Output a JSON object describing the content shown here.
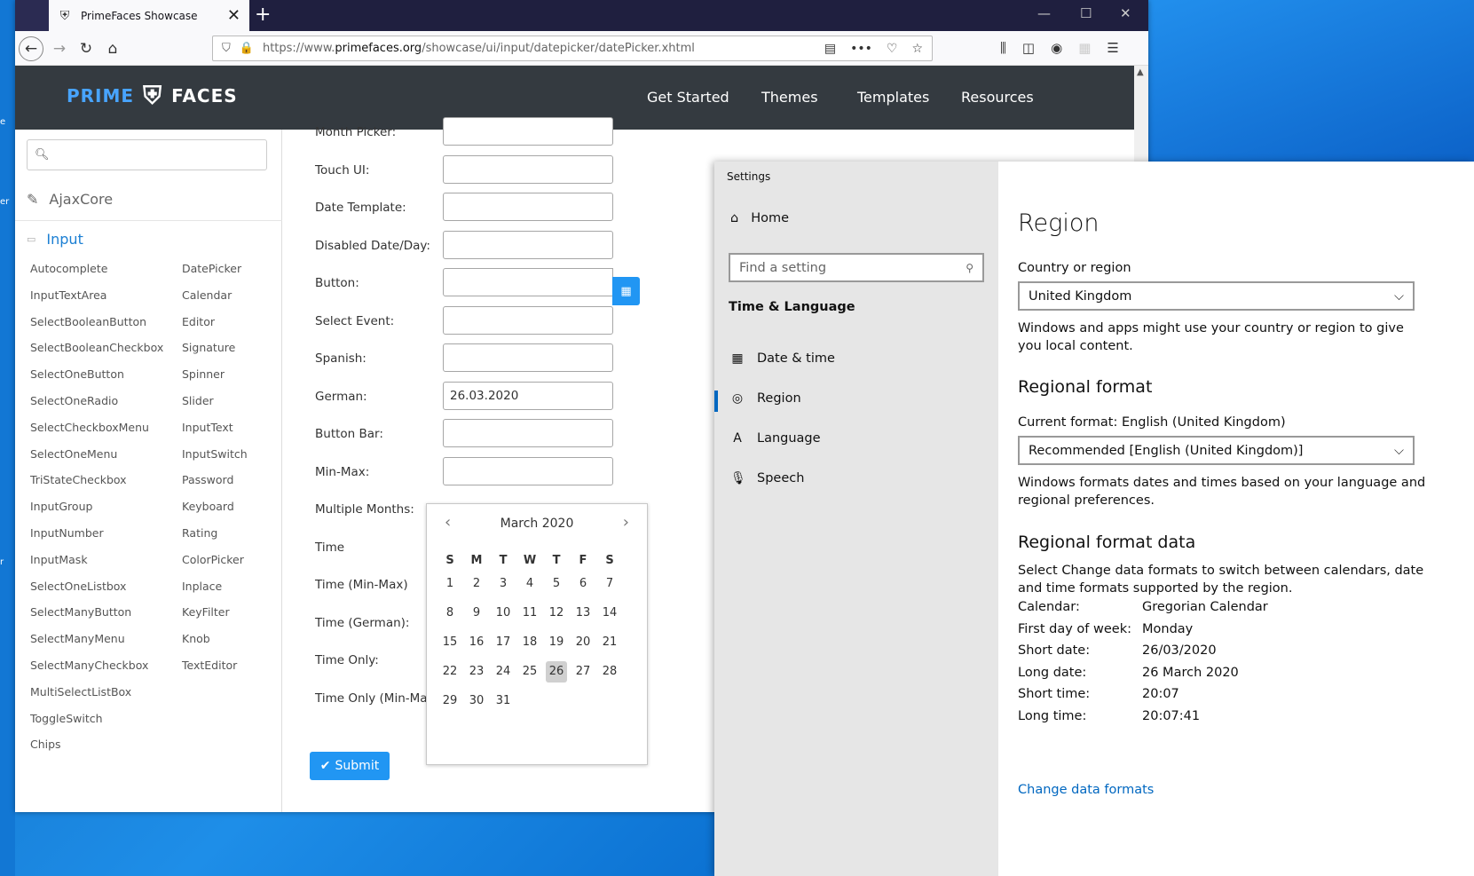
{
  "browser": {
    "tab_title": "PrimeFaces Showcase",
    "url_prefix": "https://www.",
    "url_host": "primefaces.org",
    "url_path": "/showcase/ui/input/datepicker/datePicker.xhtml"
  },
  "site": {
    "logo_left": "PRIME",
    "logo_right": "FACES",
    "menu": [
      "Get Started",
      "Themes",
      "Templates",
      "Resources"
    ]
  },
  "sidebar": {
    "categories": [
      "AjaxCore",
      "Input"
    ],
    "col1": [
      "Autocomplete",
      "InputTextArea",
      "SelectBooleanButton",
      "SelectBooleanCheckbox",
      "SelectOneButton",
      "SelectOneRadio",
      "SelectCheckboxMenu",
      "SelectOneMenu",
      "TriStateCheckbox",
      "InputGroup",
      "InputNumber",
      "InputMask",
      "SelectOneListbox",
      "SelectManyButton",
      "SelectManyMenu",
      "SelectManyCheckbox",
      "MultiSelectListBox",
      "ToggleSwitch",
      "Chips"
    ],
    "col2": [
      "DatePicker",
      "Calendar",
      "Editor",
      "Signature",
      "Spinner",
      "Slider",
      "InputText",
      "InputSwitch",
      "Password",
      "Keyboard",
      "Rating",
      "ColorPicker",
      "Inplace",
      "KeyFilter",
      "Knob",
      "TextEditor"
    ]
  },
  "form": {
    "labels": [
      "Month Picker:",
      "Touch UI:",
      "Date Template:",
      "Disabled Date/Day:",
      "Button:",
      "Select Event:",
      "Spanish:",
      "German:",
      "Button Bar:",
      "Min-Max:",
      "Multiple Months:",
      "Time",
      "Time (Min-Max)",
      "Time (German):",
      "Time Only:",
      "Time Only (Min-Max):"
    ],
    "german_value": "26.03.2020",
    "submit_label": "Submit"
  },
  "calendar": {
    "month_label": "March 2020",
    "dow": [
      "S",
      "M",
      "T",
      "W",
      "T",
      "F",
      "S"
    ],
    "weeks": [
      [
        1,
        2,
        3,
        4,
        5,
        6,
        7
      ],
      [
        8,
        9,
        10,
        11,
        12,
        13,
        14
      ],
      [
        15,
        16,
        17,
        18,
        19,
        20,
        21
      ],
      [
        22,
        23,
        24,
        25,
        26,
        27,
        28
      ],
      [
        29,
        30,
        31
      ]
    ],
    "highlighted_day": 26
  },
  "settings": {
    "window_title": "Settings",
    "home": "Home",
    "find_placeholder": "Find a setting",
    "section": "Time & Language",
    "nav": [
      "Date & time",
      "Region",
      "Language",
      "Speech"
    ],
    "page_title": "Region",
    "country_label": "Country or region",
    "country_value": "United Kingdom",
    "country_desc": "Windows and apps might use your country or region to give you local content.",
    "format_heading": "Regional format",
    "current_format": "Current format: English (United Kingdom)",
    "format_value": "Recommended [English (United Kingdom)]",
    "format_desc": "Windows formats dates and times based on your language and regional preferences.",
    "data_heading": "Regional format data",
    "data_desc": "Select Change data formats to switch between calendars, date and time formats supported by the region.",
    "data": [
      {
        "k": "Calendar:",
        "v": "Gregorian Calendar"
      },
      {
        "k": "First day of week:",
        "v": "Monday"
      },
      {
        "k": "Short date:",
        "v": "26/03/2020"
      },
      {
        "k": "Long date:",
        "v": "26 March 2020"
      },
      {
        "k": "Short time:",
        "v": "20:07"
      },
      {
        "k": "Long time:",
        "v": "20:07:41"
      }
    ],
    "change_link": "Change data formats"
  }
}
